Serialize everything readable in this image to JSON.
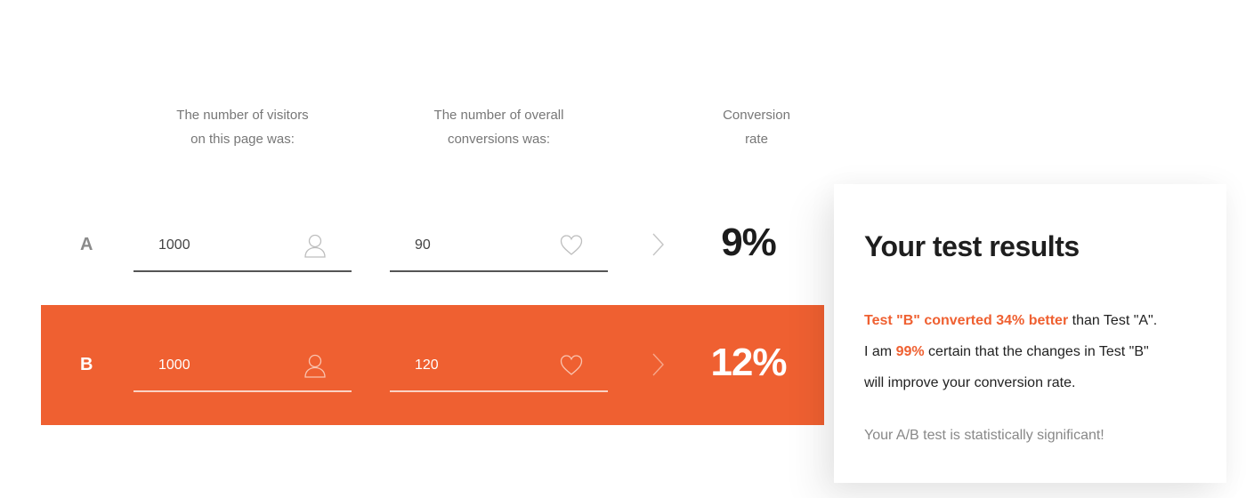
{
  "headers": {
    "visitors": {
      "line1": "The number of visitors",
      "line2": "on this page was:"
    },
    "conversions": {
      "line1": "The number of overall",
      "line2": "conversions was:"
    },
    "rate": {
      "line1": "Conversion",
      "line2": "rate"
    }
  },
  "rows": [
    {
      "label": "A",
      "visitors": "1000",
      "conversions": "90",
      "rate": "9%",
      "highlight_color": ""
    },
    {
      "label": "B",
      "visitors": "1000",
      "conversions": "120",
      "rate": "12%",
      "highlight_color": "#ef6031"
    }
  ],
  "icons": {
    "visitors": "user-icon",
    "conversions": "heart-icon",
    "arrow": "chevron-right-icon"
  },
  "results": {
    "title": "Your test results",
    "line1_highlight": "Test \"B\" converted 34% better",
    "line1_rest": " than Test \"A\".",
    "line2_pre": "I am ",
    "line2_highlight": "99%",
    "line2_rest": " certain that the changes in Test \"B\"",
    "line3": "will improve your conversion rate.",
    "footer": "Your A/B test is statistically significant!"
  },
  "colors": {
    "accent": "#ef6031",
    "text_dark": "#1e1e1e",
    "text_muted": "#777777"
  }
}
